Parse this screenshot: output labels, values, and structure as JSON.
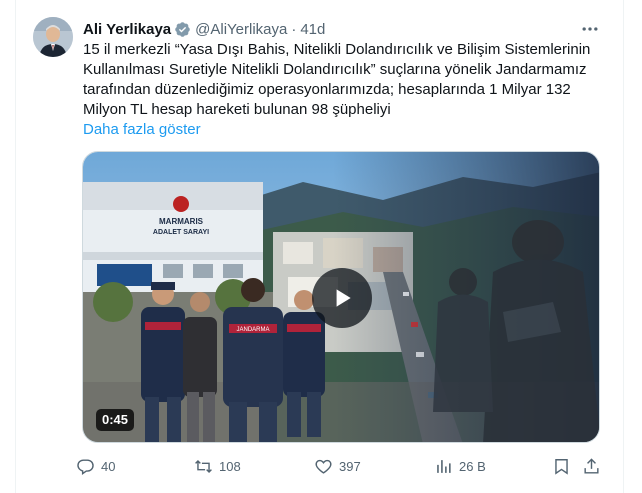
{
  "author": {
    "name": "Ali Yerlikaya",
    "handle": "@AliYerlikaya",
    "separator": "·",
    "time": "41d"
  },
  "tweet": {
    "lines": [
      "15 il merkezli “Yasa Dışı Bahis, Nitelikli Dolandırıcılık ve Bilişim Sistemlerinin",
      "Kullanılması Suretiyle Nitelikli Dolandırıcılık” suçlarına yönelik Jandarmamız",
      "tarafından düzenlediğimiz operasyonlarımızda; hesaplarında 1 Milyar 132",
      "Milyon TL hesap hareketi bulunan 98 şüpheliyi"
    ],
    "show_more": "Daha fazla göster"
  },
  "media": {
    "duration": "0:45",
    "sign_line1": "MARMARIS",
    "sign_line2": "ADALET SARAYI",
    "vest_label": "JANDARMA"
  },
  "actions": {
    "replies": "40",
    "reposts": "108",
    "likes": "397",
    "views": "26 B"
  },
  "colors": {
    "accent": "#1d9bf0",
    "text": "#0f1419",
    "muted": "#536471"
  },
  "icons": [
    "verified-badge-icon",
    "more-icon",
    "play-icon",
    "reply-icon",
    "repost-icon",
    "like-icon",
    "views-icon",
    "bookmark-icon",
    "share-icon"
  ]
}
